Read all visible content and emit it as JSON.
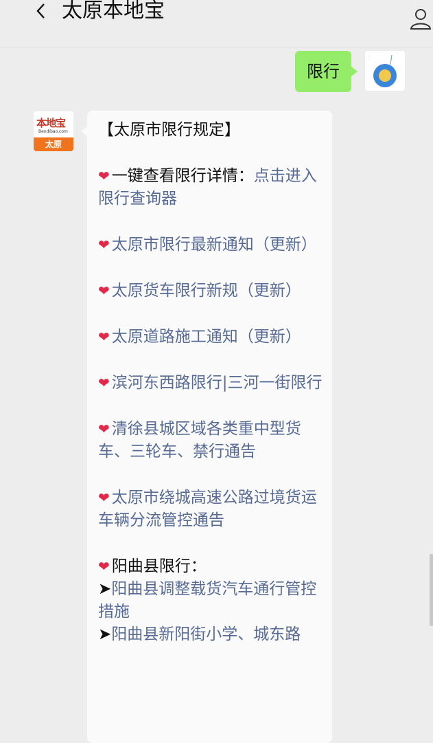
{
  "header": {
    "title": "太原本地宝"
  },
  "chat": {
    "user_message": "限行",
    "bot_avatar": {
      "logo": "本地宝",
      "url": "Bendibao.com",
      "city": "太原"
    },
    "bot_message": {
      "heading": "【太原市限行规定】",
      "item1_prefix": "一键查看限行详情：",
      "item1_link": "点击进入限行查询器",
      "item2": "太原市限行最新通知（更新）",
      "item3": "太原货车限行新规（更新）",
      "item4": "太原道路施工通知（更新）",
      "item5": "滨河东西路限行|三河一街限行",
      "item6": "清徐县城区域各类重中型货车、三轮车、禁行通告",
      "item7": "太原市绕城高速公路过境货运车辆分流管控通告",
      "item8_heading": "阳曲县限行：",
      "item8_sub1": "阳曲县调整载货汽车通行管控措施",
      "item8_sub2": "阳曲县新阳街小学、城东路"
    }
  },
  "colors": {
    "link": "#576b95",
    "green_bubble": "#95ec69",
    "heart": "#e0294a"
  }
}
